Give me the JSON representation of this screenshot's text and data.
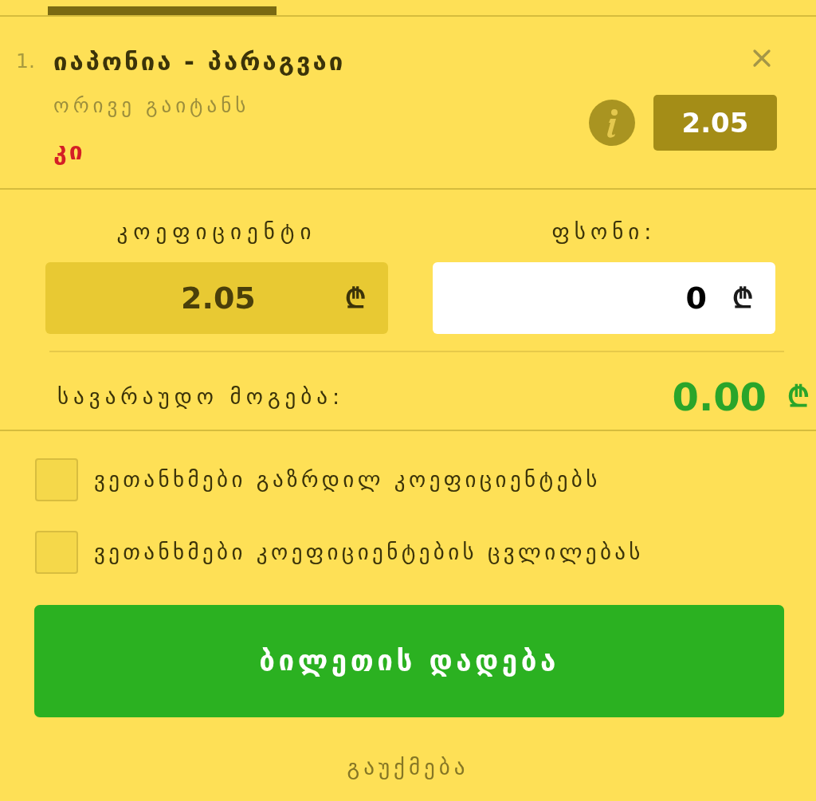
{
  "bet": {
    "number": "1.",
    "match": "იაპონია - პარაგვაი",
    "market": "ორივე გაიტანს",
    "selection": "კი",
    "odds": "2.05"
  },
  "fields": [
    {
      "kind": "odds",
      "label": "კოეფიციენტი",
      "value": "2.05",
      "currency": "₾"
    },
    {
      "kind": "stake",
      "label": "ფსონი:",
      "value": "0",
      "currency": "₾"
    }
  ],
  "potential_win": {
    "label": "სავარაუდო მოგება:",
    "value": "0.00",
    "currency": "₾"
  },
  "options": [
    {
      "label": "ვეთანხმები გაზრდილ კოეფიციენტებს",
      "checked": false
    },
    {
      "label": "ვეთანხმები კოეფიციენტების ცვლილებას",
      "checked": false
    }
  ],
  "place_bet_button": "ბილეთის დადება",
  "cancel_link": "გაუქმება"
}
